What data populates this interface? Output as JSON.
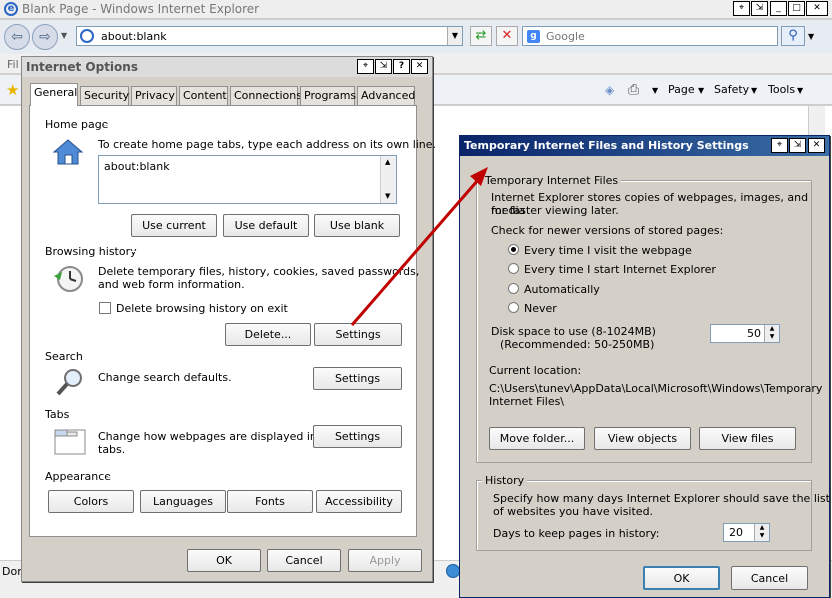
{
  "browser": {
    "title": "Blank Page - Windows Internet Explorer",
    "address": "about:blank",
    "search_placeholder": "Google",
    "menu_partial": "Fil",
    "status_partial": "Don",
    "cmd": {
      "page": "Page",
      "safety": "Safety",
      "tools": "Tools"
    }
  },
  "options": {
    "title": "Internet Options",
    "tabs": [
      "General",
      "Security",
      "Privacy",
      "Content",
      "Connections",
      "Programs",
      "Advanced"
    ],
    "home": {
      "label": "Home page",
      "desc": "To create home page tabs, type each address on its own line.",
      "value": "about:blank",
      "use_current": "Use current",
      "use_default": "Use default",
      "use_blank": "Use blank"
    },
    "history": {
      "label": "Browsing history",
      "desc1": "Delete temporary files, history, cookies, saved passwords,",
      "desc2": "and web form information.",
      "checkbox": "Delete browsing history on exit",
      "delete": "Delete...",
      "settings": "Settings"
    },
    "search": {
      "label": "Search",
      "desc": "Change search defaults.",
      "settings": "Settings"
    },
    "tabsgrp": {
      "label": "Tabs",
      "desc1": "Change how webpages are displayed in",
      "desc2": "tabs.",
      "settings": "Settings"
    },
    "appearance": {
      "label": "Appearance",
      "colors": "Colors",
      "languages": "Languages",
      "fonts": "Fonts",
      "accessibility": "Accessibility"
    },
    "ok": "OK",
    "cancel": "Cancel",
    "apply": "Apply"
  },
  "tif": {
    "title": "Temporary Internet Files and History Settings",
    "group": "Temporary Internet Files",
    "desc1": "Internet Explorer stores copies of webpages, images, and media",
    "desc2": "for faster viewing later.",
    "check": "Check for newer versions of stored pages:",
    "options": [
      "Every time I visit the webpage",
      "Every time I start Internet Explorer",
      "Automatically",
      "Never"
    ],
    "disk1": "Disk space to use (8-1024MB)",
    "disk2": "(Recommended: 50-250MB)",
    "disk_value": "50",
    "loc_label": "Current location:",
    "loc1": "C:\\Users\\tunev\\AppData\\Local\\Microsoft\\Windows\\Temporary",
    "loc2": "Internet Files\\",
    "move": "Move folder...",
    "view_objects": "View objects",
    "view_files": "View files",
    "history": "History",
    "hdesc1": "Specify how many days Internet Explorer should save the list",
    "hdesc2": "of websites you have visited.",
    "days_label": "Days to keep pages in history:",
    "days_value": "20",
    "ok": "OK",
    "cancel": "Cancel"
  },
  "colors": {
    "ie_title": "#eeeeee",
    "dialog_title_active": "#0a246a",
    "arrow": "#c00000"
  }
}
